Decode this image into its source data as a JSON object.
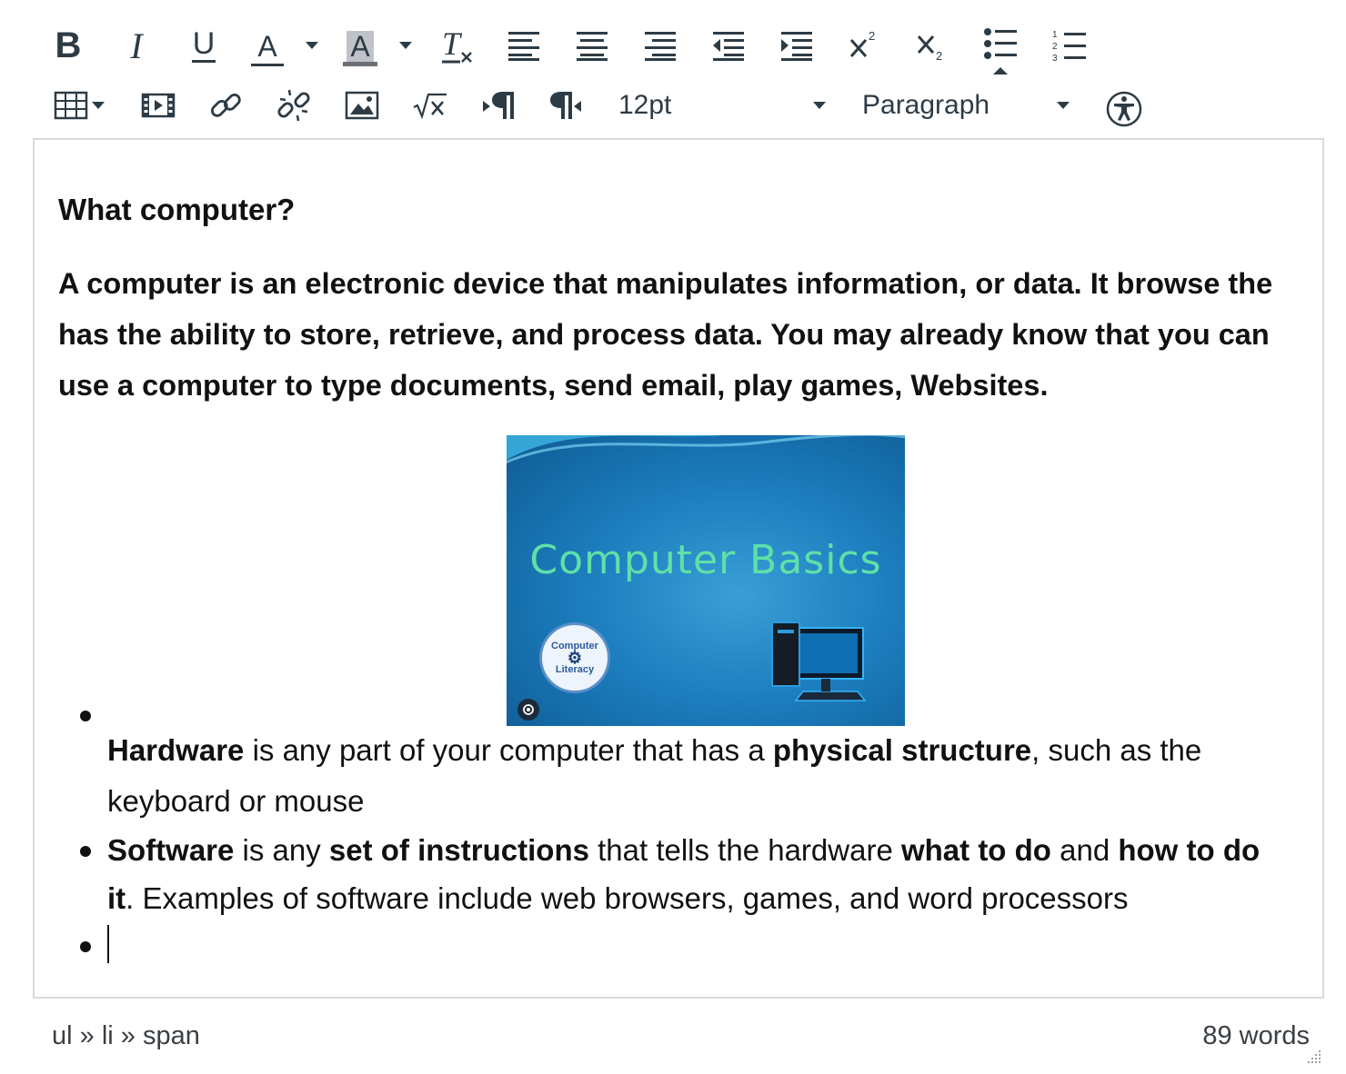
{
  "toolbar": {
    "row1": [
      {
        "name": "bold-button",
        "glyph": "B"
      },
      {
        "name": "italic-button",
        "glyph": "I"
      },
      {
        "name": "underline-button",
        "glyph": "U"
      },
      {
        "name": "text-color-button",
        "glyph": "A"
      },
      {
        "name": "background-color-button",
        "glyph": "A"
      },
      {
        "name": "clear-formatting-button",
        "glyph": "T"
      }
    ],
    "font_size": "12pt",
    "block_format": "Paragraph"
  },
  "content": {
    "heading": "What computer?",
    "intro": "A computer is an electronic device that manipulates information, or data. It browse the has the ability to store, retrieve, and process data. You may already know that you can use a computer to type documents, send email, play games, Websites.",
    "image": {
      "title": "Computer Basics",
      "badge_top": "Computer",
      "badge_bottom": "Literacy"
    },
    "list": [
      {
        "b1": "Hardware",
        "t1": " is any part of your computer that has a ",
        "b2": "physical structure",
        "t2": ", such as the",
        "t3": "keyboard or mouse"
      },
      {
        "b1": "Software",
        "t1": " is any ",
        "b2": "set of instructions",
        "t2": " that tells the hardware ",
        "b3": "what to do",
        "t3": " and ",
        "b4": "how to do",
        "b5": "it",
        "t4": ". Examples of software include web browsers, games, and word processors"
      }
    ]
  },
  "status": {
    "path": "ul » li » span",
    "word_count": "89 words"
  },
  "colors": {
    "icon": "#2d3b45",
    "border": "#d7dadc",
    "image_bg": "#1d7fbf",
    "image_title": "#5fe0a8"
  }
}
